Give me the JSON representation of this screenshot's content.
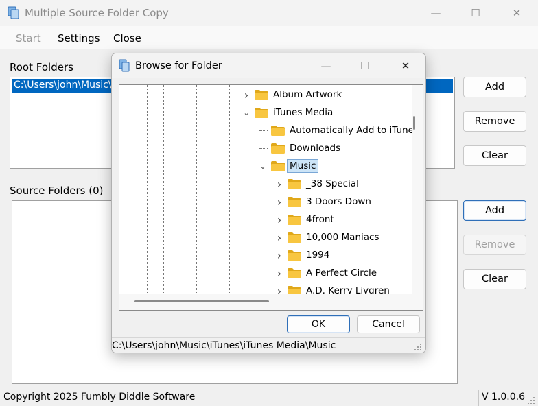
{
  "window": {
    "title": "Multiple Source Folder Copy",
    "minimize_glyph": "—",
    "maximize_glyph": "☐",
    "close_glyph": "✕"
  },
  "menu": {
    "start": "Start",
    "settings": "Settings",
    "close": "Close"
  },
  "root_folders": {
    "label": "Root Folders",
    "items": [
      "C:\\Users\\john\\Music\\iTunes\\iTunes Media\\Music"
    ],
    "add": "Add",
    "remove": "Remove",
    "clear": "Clear"
  },
  "source_folders": {
    "label": "Source Folders (0)",
    "add": "Add",
    "remove": "Remove",
    "clear": "Clear"
  },
  "status": {
    "copyright": "Copyright 2025 Fumbly Diddle Software",
    "version": "V 1.0.0.6"
  },
  "dialog": {
    "title": "Browse for Folder",
    "minimize_glyph": "—",
    "maximize_glyph": "☐",
    "close_glyph": "✕",
    "tree": [
      {
        "label": "Album Artwork",
        "level": 0,
        "expander": "collapsed"
      },
      {
        "label": "iTunes Media",
        "level": 0,
        "expander": "expanded"
      },
      {
        "label": "Automatically Add to iTunes",
        "level": 1,
        "expander": "none"
      },
      {
        "label": "Downloads",
        "level": 1,
        "expander": "none"
      },
      {
        "label": "Music",
        "level": 1,
        "expander": "expanded",
        "selected": true
      },
      {
        "label": "_38 Special",
        "level": 2,
        "expander": "collapsed"
      },
      {
        "label": "3 Doors Down",
        "level": 2,
        "expander": "collapsed"
      },
      {
        "label": "4front",
        "level": 2,
        "expander": "collapsed"
      },
      {
        "label": "10,000 Maniacs",
        "level": 2,
        "expander": "collapsed"
      },
      {
        "label": "1994",
        "level": 2,
        "expander": "collapsed"
      },
      {
        "label": "A Perfect Circle",
        "level": 2,
        "expander": "collapsed"
      },
      {
        "label": "A.D.  Kerry Livgren",
        "level": 2,
        "expander": "collapsed"
      }
    ],
    "ok": "OK",
    "cancel": "Cancel",
    "selected_path": "C:\\Users\\john\\Music\\iTunes\\iTunes Media\\Music"
  },
  "colors": {
    "selection": "#0067c0",
    "folder": "#f8c640",
    "folder_dark": "#e0a81a",
    "accent_border": "#2f6fb8"
  }
}
